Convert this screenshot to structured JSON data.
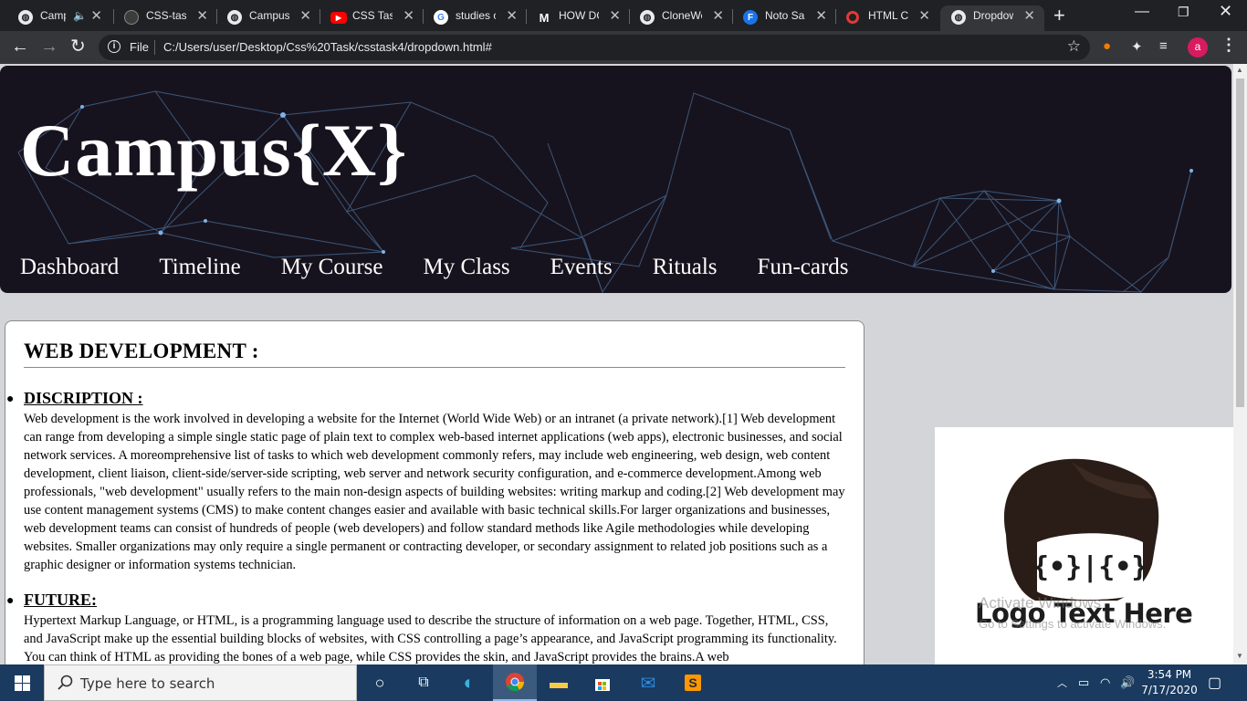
{
  "browser": {
    "tabs": [
      {
        "title": "Camp",
        "favicon": "globe-icon",
        "extra": "mute-icon"
      },
      {
        "title": "CSS-task",
        "favicon": "github-icon"
      },
      {
        "title": "Campus",
        "favicon": "globe-icon"
      },
      {
        "title": "CSS Task",
        "favicon": "youtube-icon"
      },
      {
        "title": "studies o",
        "favicon": "google-icon"
      },
      {
        "title": "HOW DO",
        "favicon": "medium-icon"
      },
      {
        "title": "CloneWe",
        "favicon": "globe-icon"
      },
      {
        "title": "Noto San",
        "favicon": "f-icon"
      },
      {
        "title": "HTML Co",
        "favicon": "opera-icon"
      },
      {
        "title": "Dropdow",
        "favicon": "globe-icon",
        "active": true
      }
    ],
    "omnibox": {
      "scheme_label": "File",
      "url": "C:/Users/user/Desktop/Css%20Task/csstask4/dropdown.html#"
    },
    "profile_initial": "a"
  },
  "page": {
    "site_title": "Campus{X}",
    "nav": [
      "Dashboard",
      "Timeline",
      "My Course",
      "My Class",
      "Events",
      "Rituals",
      "Fun-cards"
    ],
    "card": {
      "heading": "WEB DEVELOPMENT :",
      "sections": [
        {
          "title": "DISCRIPTION :",
          "body": "Web development is the work involved in developing a website for the Internet (World Wide Web) or an intranet (a private network).[1] Web development can range from developing a simple single static page of plain text to complex web-based internet applications (web apps), electronic businesses, and social network services. A moreomprehensive list of tasks to which web development commonly refers, may include web engineering, web design, web content development, client liaison, client-side/server-side scripting, web server and network security configuration, and e-commerce development.Among web professionals, \"web development\" usually refers to the main non-design aspects of building websites: writing markup and coding.[2] Web development may use content management systems (CMS) to make content changes easier and available with basic technical skills.For larger organizations and businesses, web development teams can consist of hundreds of people (web developers) and follow standard methods like Agile methodologies while developing websites. Smaller organizations may only require a single permanent or contracting developer, or secondary assignment to related job positions such as a graphic designer or information systems technician."
        },
        {
          "title": "FUTURE:",
          "body": "Hypertext Markup Language, or HTML, is a programming language used to describe the structure of information on a web page. Together, HTML, CSS, and JavaScript make up the essential building blocks of websites, with CSS controlling a page’s appearance, and JavaScript programming its functionality. You can think of HTML as providing the bones of a web page, while CSS provides the skin, and JavaScript provides the brains.A web"
        }
      ]
    },
    "ad": {
      "logo_glyphs": "{•}|{•}",
      "logo_text": "Logo Text Here"
    },
    "watermark": {
      "line1": "Activate Windows",
      "line2": "Go to Settings to activate Windows."
    }
  },
  "taskbar": {
    "search_placeholder": "Type here to search",
    "time": "3:54 PM",
    "date": "7/17/2020"
  },
  "colors": {
    "hero_bg": "#17131e",
    "hero_lines": "#5b8fc4",
    "page_bg": "#d3d5d9",
    "taskbar_bg": "#1a3a5f"
  }
}
